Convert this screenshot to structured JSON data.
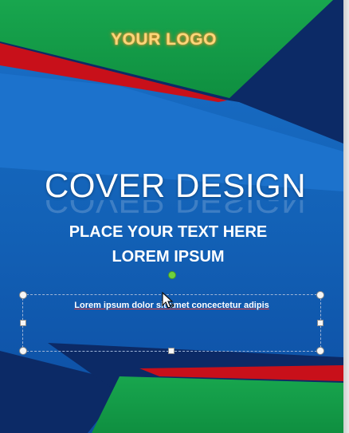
{
  "logo": {
    "text": "YOUR LOGO"
  },
  "cover": {
    "title": "COVER DESIGN",
    "subtitle_line1": "PLACE YOUR TEXT HERE",
    "subtitle_line2": "LOREM IPSUM"
  },
  "textbox": {
    "text": "Lorem ipsum dolor sit amet concectetur adipis"
  },
  "colors": {
    "green": "#15a04a",
    "navy": "#0c2a66",
    "blue": "#1560b5",
    "red": "#c8101a",
    "logo_text": "#fcd77a"
  },
  "icons": {
    "cursor": "arrow-move-cursor-icon"
  }
}
